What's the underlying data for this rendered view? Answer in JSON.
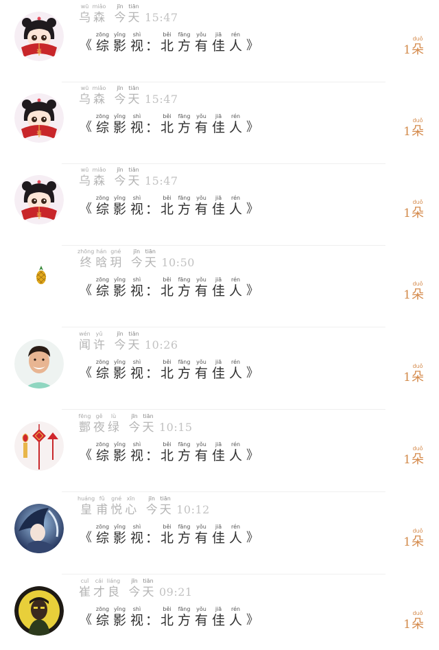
{
  "title": {
    "open_quote": "《",
    "close_quote": "》",
    "colon": "：",
    "chars": [
      {
        "c": "综",
        "p": "zōng"
      },
      {
        "c": "影",
        "p": "yǐng"
      },
      {
        "c": "视",
        "p": "shì"
      }
    ],
    "chars2": [
      {
        "c": "北",
        "p": "běi"
      },
      {
        "c": "方",
        "p": "fāng"
      },
      {
        "c": "有",
        "p": "yǒu"
      },
      {
        "c": "佳",
        "p": "jiā"
      },
      {
        "c": "人",
        "p": "rén"
      }
    ]
  },
  "count": {
    "number": "1",
    "unit": {
      "c": "朵",
      "p": "duǒ"
    }
  },
  "date_word": [
    {
      "c": "今",
      "p": "jīn"
    },
    {
      "c": "天",
      "p": "tiān"
    }
  ],
  "items": [
    {
      "avatar": "anime-girl-avatar",
      "name": [
        {
          "c": "乌",
          "p": "wū"
        },
        {
          "c": "森",
          "p": "miǎo"
        }
      ],
      "time": "15:47"
    },
    {
      "avatar": "anime-girl-avatar",
      "name": [
        {
          "c": "乌",
          "p": "wū"
        },
        {
          "c": "森",
          "p": "miǎo"
        }
      ],
      "time": "15:47"
    },
    {
      "avatar": "anime-girl-avatar",
      "name": [
        {
          "c": "乌",
          "p": "wū"
        },
        {
          "c": "森",
          "p": "miǎo"
        }
      ],
      "time": "15:47"
    },
    {
      "avatar": "pineapple-icon",
      "name": [
        {
          "c": "终",
          "p": "zhōng"
        },
        {
          "c": "晗",
          "p": "hán"
        },
        {
          "c": "玥",
          "p": "gné"
        }
      ],
      "time": "10:50"
    },
    {
      "avatar": "smiling-man-avatar",
      "name": [
        {
          "c": "闻",
          "p": "wén"
        },
        {
          "c": "许",
          "p": "yǔ"
        }
      ],
      "time": "10:26"
    },
    {
      "avatar": "chinese-knot-avatar",
      "name": [
        {
          "c": "酆",
          "p": "fēng"
        },
        {
          "c": "夜",
          "p": "gě"
        },
        {
          "c": "绿",
          "p": "lù"
        }
      ],
      "time": "10:15"
    },
    {
      "avatar": "anime-blue-avatar",
      "name": [
        {
          "c": "皇",
          "p": "huáng"
        },
        {
          "c": "甫",
          "p": "fǔ"
        },
        {
          "c": "悦",
          "p": "gné"
        },
        {
          "c": "心",
          "p": "xīn"
        }
      ],
      "time": "10:12"
    },
    {
      "avatar": "portrait-yellow-avatar",
      "name": [
        {
          "c": "崔",
          "p": "cuī"
        },
        {
          "c": "才",
          "p": "cái"
        },
        {
          "c": "良",
          "p": "liáng"
        }
      ],
      "time": "09:21"
    }
  ],
  "colors": {
    "accent": "#d4894a",
    "muted_text": "#b5b5b5",
    "divider": "#efefef"
  }
}
